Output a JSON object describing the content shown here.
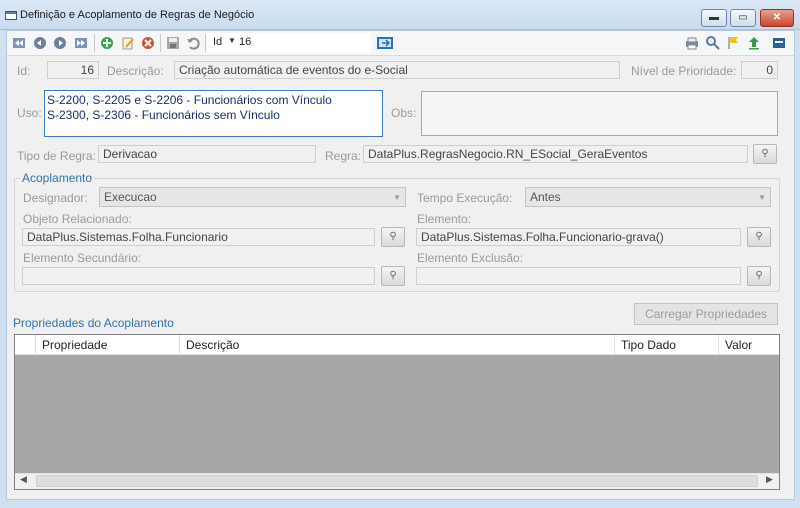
{
  "window": {
    "title": "Definição e Acoplamento de Regras de Negócio",
    "btn_min": "▬",
    "btn_max": "▭",
    "btn_close": "✕"
  },
  "toolbar": {
    "search_field": "Id",
    "search_value": "16",
    "icons": [
      "first-icon",
      "prev-icon",
      "next-icon",
      "last-icon",
      "add-icon",
      "edit-icon",
      "delete-icon",
      "save-icon",
      "undo-icon",
      "go-icon",
      "print-icon",
      "settings-icon",
      "flag-icon",
      "upload-icon",
      "panel-icon"
    ]
  },
  "form": {
    "id_label": "Id:",
    "id_value": "16",
    "descricao_label": "Descrição:",
    "descricao_value": "Criação automática de eventos do e-Social",
    "prioridade_label": "Nível de Prioridade:",
    "prioridade_value": "0",
    "uso_label": "Uso:",
    "uso_line1": "S-2200, S-2205 e S-2206 - Funcionários com Vínculo",
    "uso_line2": "S-2300, S-2306 - Funcionários sem Vínculo",
    "obs_label": "Obs:",
    "obs_value": "",
    "tipo_regra_label": "Tipo de Regra:",
    "tipo_regra_value": "Derivacao",
    "regra_label": "Regra:",
    "regra_value": "DataPlus.RegrasNegocio.RN_ESocial_GeraEventos"
  },
  "acoplamento": {
    "title": "Acoplamento",
    "designador_label": "Designador:",
    "designador_value": "Execucao",
    "tempo_label": "Tempo Execução:",
    "tempo_value": "Antes",
    "objeto_label": "Objeto Relacionado:",
    "objeto_value": "DataPlus.Sistemas.Folha.Funcionario",
    "elemento_label": "Elemento:",
    "elemento_value": "DataPlus.Sistemas.Folha.Funcionario-grava()",
    "secundario_label": "Elemento Secundário:",
    "secundario_value": "",
    "exclusao_label": "Elemento Exclusão:",
    "exclusao_value": ""
  },
  "propriedades": {
    "title": "Propriedades do Acoplamento",
    "carregar_label": "Carregar Propriedades",
    "columns": [
      "Propriedade",
      "Descrição",
      "Tipo Dado",
      "Valor"
    ]
  },
  "colors": {
    "accent": "#3072b5",
    "uso_border": "#3d7bc4",
    "grid_background": "#a7a7a7"
  }
}
